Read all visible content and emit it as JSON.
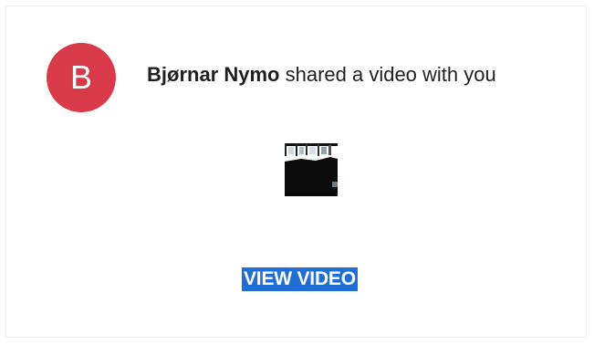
{
  "notification": {
    "avatar_initial": "B",
    "sender_name": "Bjørnar Nymo",
    "message": " shared a video with you",
    "button_label": "VIEW VIDEO"
  },
  "colors": {
    "avatar_background": "#d83a4a",
    "button_background": "#1f6fd6"
  },
  "icons": {
    "thumbnail": "video-thumbnail"
  }
}
